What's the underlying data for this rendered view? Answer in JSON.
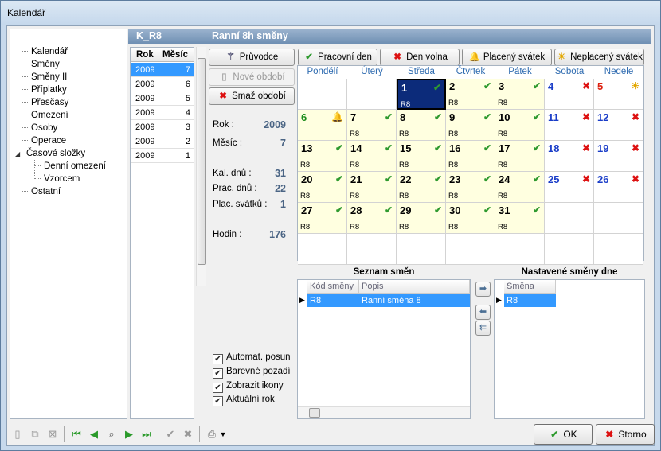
{
  "window": {
    "title": "Kalendář"
  },
  "tree": {
    "items": [
      "Kalendář",
      "Směny",
      "Směny II",
      "Příplatky",
      "Přesčasy",
      "Omezení",
      "Osoby",
      "Operace",
      "Časové složky",
      "Denní omezení",
      "Vzorcem",
      "Ostatní"
    ]
  },
  "header": {
    "code": "K_R8",
    "name": "Ranní 8h směny"
  },
  "years": {
    "col_year": "Rok",
    "col_month": "Měsíc",
    "rows": [
      {
        "year": "2009",
        "month": "7"
      },
      {
        "year": "2009",
        "month": "6"
      },
      {
        "year": "2009",
        "month": "5"
      },
      {
        "year": "2009",
        "month": "4"
      },
      {
        "year": "2009",
        "month": "3"
      },
      {
        "year": "2009",
        "month": "2"
      },
      {
        "year": "2009",
        "month": "1"
      }
    ]
  },
  "buttons": {
    "pruvodce": "Průvodce",
    "nove_obdobi": "Nové období",
    "smaz_obdobi": "Smaž období",
    "pracovni_den": "Pracovní den",
    "den_volna": "Den volna",
    "placeny_svatek": "Placený svátek",
    "neplaceny_svatek": "Neplacený svátek",
    "ok": "OK",
    "storno": "Storno"
  },
  "stats": {
    "rok_label": "Rok :",
    "rok": "2009",
    "mesic_label": "Měsíc :",
    "mesic": "7",
    "kal_label": "Kal. dnů :",
    "kal": "31",
    "prac_label": "Prac. dnů :",
    "prac": "22",
    "plac_label": "Plac. svátků :",
    "plac": "1",
    "hodin_label": "Hodin :",
    "hodin": "176"
  },
  "calendar": {
    "days": [
      "Pondělí",
      "Úterý",
      "Středa",
      "Čtvrtek",
      "Pátek",
      "Sobota",
      "Nedele"
    ],
    "cells": [
      {
        "n": "1",
        "code": "R8",
        "mk": "✔",
        "t": "sel"
      },
      {
        "n": "2",
        "code": "R8",
        "mk": "✔",
        "t": "work"
      },
      {
        "n": "3",
        "code": "R8",
        "mk": "✔",
        "t": "work"
      },
      {
        "n": "4",
        "code": "",
        "mk": "✖",
        "t": "sat"
      },
      {
        "n": "5",
        "code": "",
        "mk": "☀",
        "t": "sun"
      },
      {
        "n": "6",
        "code": "",
        "mk": "🔔",
        "t": "hol"
      },
      {
        "n": "7",
        "code": "R8",
        "mk": "✔",
        "t": "work"
      },
      {
        "n": "8",
        "code": "R8",
        "mk": "✔",
        "t": "work"
      },
      {
        "n": "9",
        "code": "R8",
        "mk": "✔",
        "t": "work"
      },
      {
        "n": "10",
        "code": "R8",
        "mk": "✔",
        "t": "work"
      },
      {
        "n": "11",
        "code": "",
        "mk": "✖",
        "t": "sat"
      },
      {
        "n": "12",
        "code": "",
        "mk": "✖",
        "t": "sunb"
      },
      {
        "n": "13",
        "code": "R8",
        "mk": "✔",
        "t": "work"
      },
      {
        "n": "14",
        "code": "R8",
        "mk": "✔",
        "t": "work"
      },
      {
        "n": "15",
        "code": "R8",
        "mk": "✔",
        "t": "work"
      },
      {
        "n": "16",
        "code": "R8",
        "mk": "✔",
        "t": "work"
      },
      {
        "n": "17",
        "code": "R8",
        "mk": "✔",
        "t": "work"
      },
      {
        "n": "18",
        "code": "",
        "mk": "✖",
        "t": "sat"
      },
      {
        "n": "19",
        "code": "",
        "mk": "✖",
        "t": "sunb"
      },
      {
        "n": "20",
        "code": "R8",
        "mk": "✔",
        "t": "work"
      },
      {
        "n": "21",
        "code": "R8",
        "mk": "✔",
        "t": "work"
      },
      {
        "n": "22",
        "code": "R8",
        "mk": "✔",
        "t": "work"
      },
      {
        "n": "23",
        "code": "R8",
        "mk": "✔",
        "t": "work"
      },
      {
        "n": "24",
        "code": "R8",
        "mk": "✔",
        "t": "work"
      },
      {
        "n": "25",
        "code": "",
        "mk": "✖",
        "t": "sat"
      },
      {
        "n": "26",
        "code": "",
        "mk": "✖",
        "t": "sunb"
      },
      {
        "n": "27",
        "code": "R8",
        "mk": "✔",
        "t": "work"
      },
      {
        "n": "28",
        "code": "R8",
        "mk": "✔",
        "t": "work"
      },
      {
        "n": "29",
        "code": "R8",
        "mk": "✔",
        "t": "work"
      },
      {
        "n": "30",
        "code": "R8",
        "mk": "✔",
        "t": "work"
      },
      {
        "n": "31",
        "code": "R8",
        "mk": "✔",
        "t": "work"
      }
    ]
  },
  "shift_list": {
    "title": "Seznam směn",
    "col_code": "Kód směny",
    "col_desc": "Popis",
    "row_code": "R8",
    "row_desc": "Ranní směna 8"
  },
  "day_shifts": {
    "title": "Nastavené směny dne",
    "col": "Směna",
    "row": "R8"
  },
  "checks": {
    "auto": "Automat. posun",
    "barevne": "Barevné pozadí",
    "ikony": "Zobrazit ikony",
    "aktualni": "Aktuální rok"
  }
}
